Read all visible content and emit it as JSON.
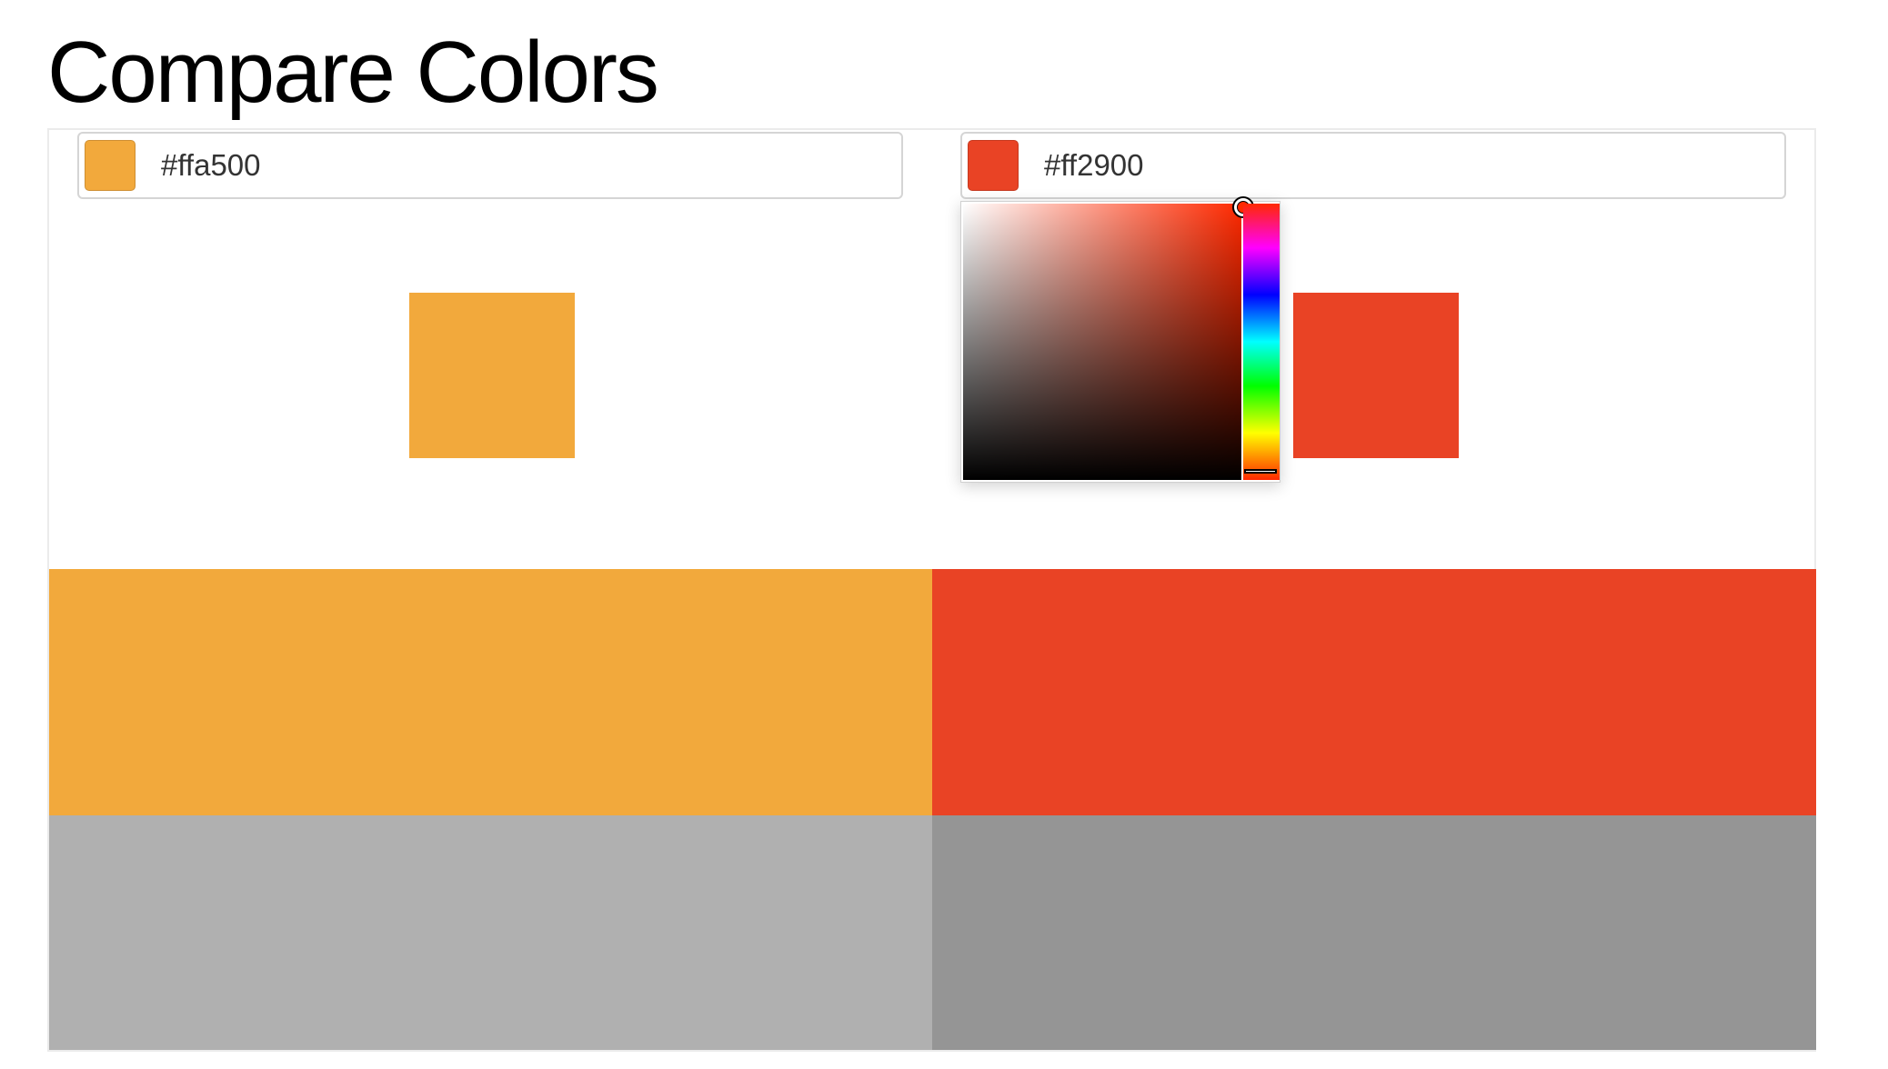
{
  "page": {
    "title": "Compare Colors"
  },
  "left": {
    "hex_value": "#ffa500",
    "color": "#f2a93c",
    "grayscale": "#b0b0b0"
  },
  "right": {
    "hex_value": "#ff2900",
    "color": "#e94325",
    "grayscale": "#959595"
  },
  "picker": {
    "open_for": "right",
    "hue_color": "#ff2900"
  },
  "icons": {
    "left_swatch": "color-swatch-icon",
    "right_swatch": "color-swatch-icon",
    "saturation_handle": "circle-handle-icon",
    "hue_handle": "slider-handle-icon"
  }
}
